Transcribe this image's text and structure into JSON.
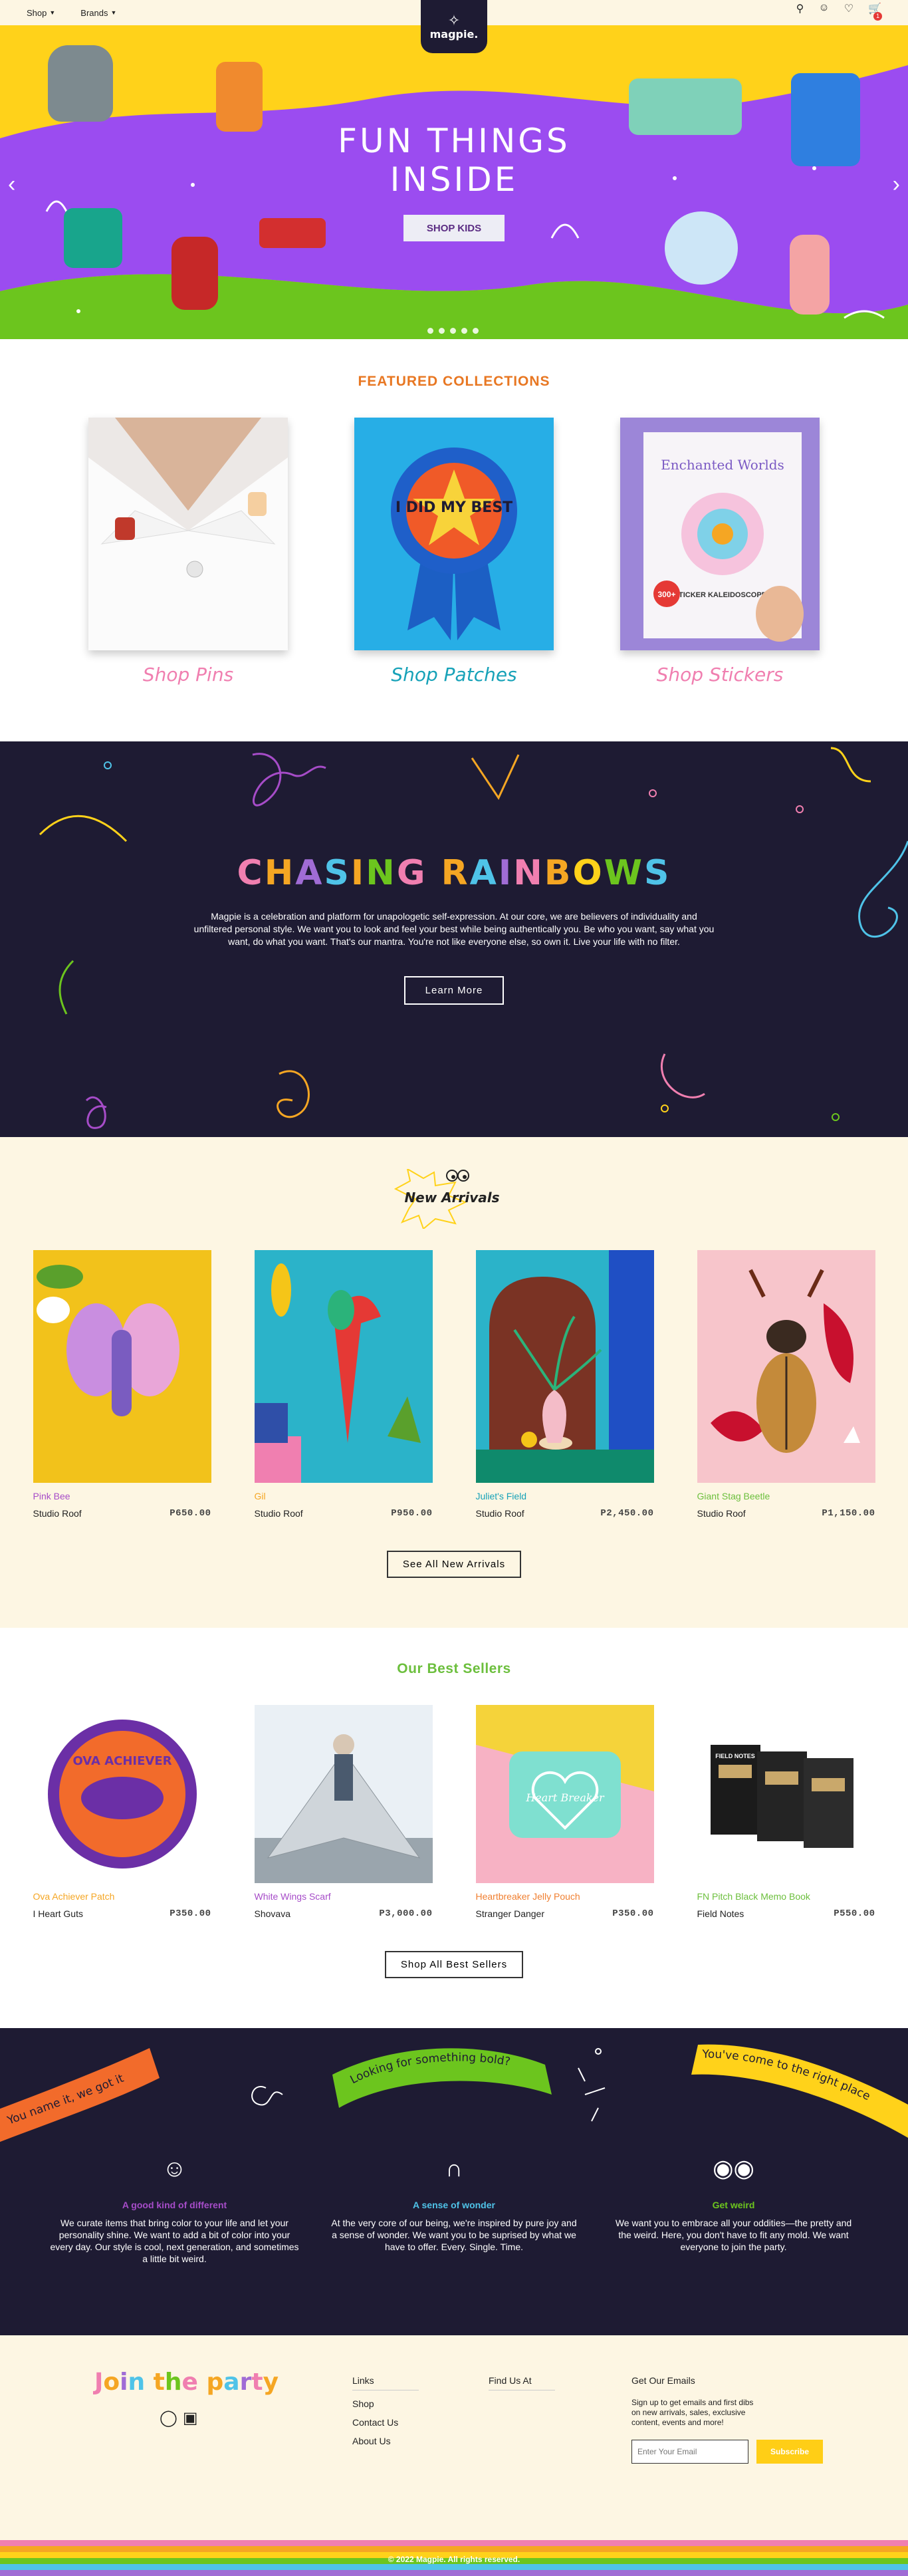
{
  "header": {
    "nav": [
      "Shop",
      "Brands"
    ],
    "logo_text": "magpie.",
    "cart_count": "1"
  },
  "hero": {
    "title_line1": "FUN THINGS",
    "title_line2": "INSIDE",
    "button": "SHOP KIDS",
    "slide_count": 5,
    "colors": {
      "yellow": "#ffd21a",
      "purple": "#9b4cf0",
      "green": "#6cc51e"
    }
  },
  "featured": {
    "title": "FEATURED COLLECTIONS",
    "collections": [
      {
        "label": "Shop Pins",
        "color": "#f07fb0"
      },
      {
        "label": "Shop Patches",
        "color": "#17a2b8"
      },
      {
        "label": "Shop Stickers",
        "color": "#f07fb0"
      }
    ],
    "patch_text": "I DID MY BEST",
    "sticker_book": {
      "title": "Enchanted Worlds",
      "subtitle": "STICKER KALEIDOSCOPES",
      "badge": "300+"
    }
  },
  "rainbows": {
    "title": "CHASING RAINBOWS",
    "text": "Magpie is a celebration and platform for unapologetic self-expression. At our core, we are believers of individuality and unfiltered personal style. We want you to look and feel your best while being authentically you. Be who you want, say what you want, do what you want. That's our mantra. You're not like everyone else, so own it. Live your life with no filter.",
    "button": "Learn More",
    "letter_colors": [
      "#f07fb0",
      "#f5a623",
      "#a06cd5",
      "#4fc3e8",
      "#f5a623",
      "#6cc51e",
      "#f07fb0",
      "#f5a623",
      "#4fc3e8",
      "#a06cd5",
      "#f07fb0",
      "#f5a623",
      "#ffd21a",
      "#6cc51e",
      "#4fc3e8",
      "#a06cd5"
    ]
  },
  "arrivals": {
    "title": "New Arrivals",
    "button": "See All New Arrivals",
    "products": [
      {
        "name": "Pink Bee",
        "vendor": "Studio Roof",
        "price": "P650.00",
        "color": "#a64cc8"
      },
      {
        "name": "Gil",
        "vendor": "Studio Roof",
        "price": "P950.00",
        "color": "#f5a623"
      },
      {
        "name": "Juliet's Field",
        "vendor": "Studio Roof",
        "price": "P2,450.00",
        "color": "#17a2b8"
      },
      {
        "name": "Giant Stag Beetle",
        "vendor": "Studio Roof",
        "price": "P1,150.00",
        "color": "#6cbf3d"
      }
    ]
  },
  "best": {
    "title": "Our Best Sellers",
    "button": "Shop All Best Sellers",
    "products": [
      {
        "name": "Ova Achiever Patch",
        "vendor": "I Heart Guts",
        "price": "P350.00",
        "color": "#f5a623"
      },
      {
        "name": "White Wings Scarf",
        "vendor": "Shovava",
        "price": "P3,000.00",
        "color": "#a64cc8"
      },
      {
        "name": "Heartbreaker Jelly Pouch",
        "vendor": "Stranger Danger",
        "price": "P350.00",
        "color": "#f07f30"
      },
      {
        "name": "FN Pitch Black Memo Book",
        "vendor": "Field Notes",
        "price": "P550.00",
        "color": "#6cbf3d"
      }
    ],
    "patch_text": "OVA ACHIEVER",
    "pouch_text": "Heart Breaker",
    "book_label": "FIELD NOTES"
  },
  "values": {
    "ribbons": [
      "You name it, we got it",
      "Looking for something bold?",
      "You've come to the right place"
    ],
    "columns": [
      {
        "title": "A good kind of different",
        "color": "#a64cc8",
        "icon": "smiley-icon",
        "text": "We curate items that bring color to your life and let your personality shine. We want to add a bit of color into your every day. Our style is cool, next generation, and sometimes a little bit weird."
      },
      {
        "title": "A sense of wonder",
        "color": "#4fc3e8",
        "icon": "rainbow-icon",
        "text": "At the very core of our being, we're inspired by pure joy and a sense of wonder. We want you to be suprised by what we have to offer. Every. Single. Time."
      },
      {
        "title": "Get weird",
        "color": "#6cc51e",
        "icon": "googly-eyes-icon",
        "text": "We want you to embrace all your oddities—the pretty and the weird. Here, you don't have to fit any mold. We want everyone to join the party."
      }
    ]
  },
  "footer": {
    "join": "Join the party",
    "links_title": "Links",
    "links": [
      "Shop",
      "Contact Us",
      "About Us"
    ],
    "find_title": "Find Us At",
    "email_title": "Get Our Emails",
    "email_text": "Sign up to get emails and first dibs on new arrivals, sales, exclusive content, events and more!",
    "email_placeholder": "Enter Your Email",
    "subscribe": "Subscribe",
    "copyright": "© 2022 Magpie. All rights reserved.",
    "stripe_colors": [
      "#f07fb0",
      "#f5a623",
      "#ffd21a",
      "#6cc51e",
      "#4fc3e8",
      "#a06cd5"
    ]
  }
}
